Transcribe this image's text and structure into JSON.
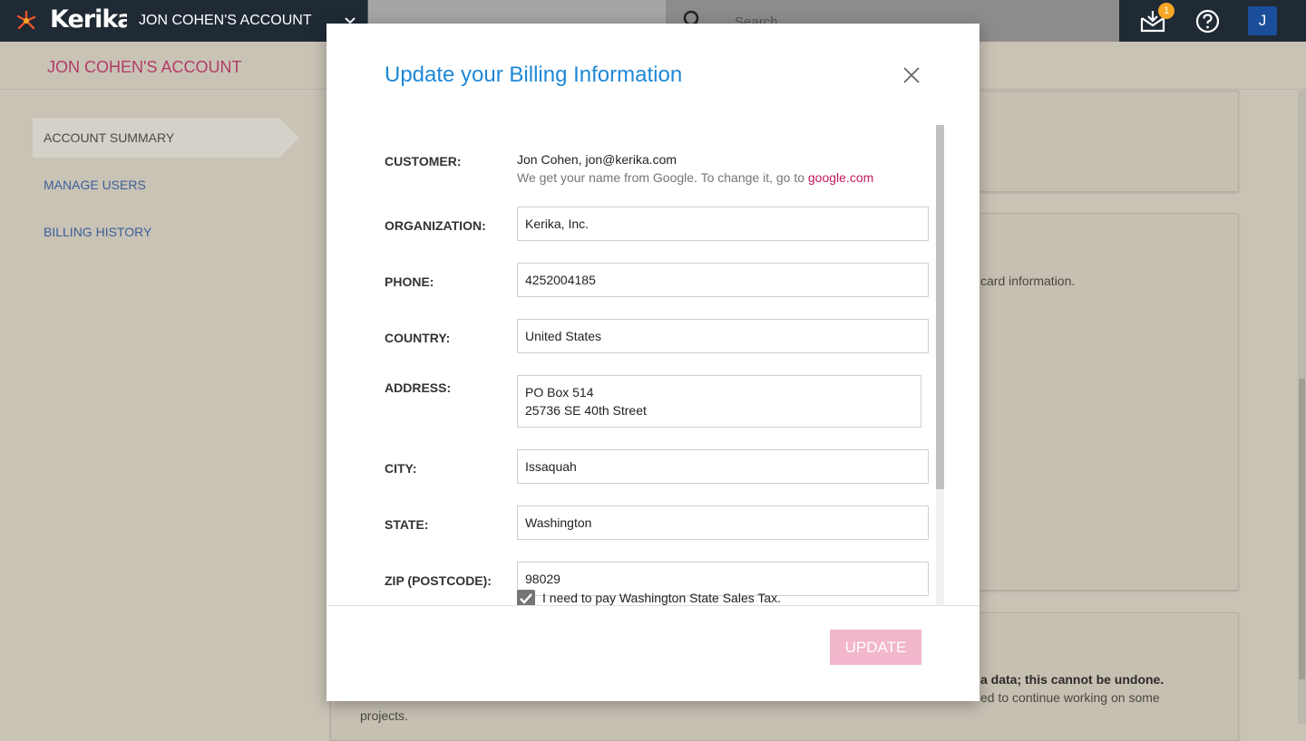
{
  "topbar": {
    "logo_text": "Kerika",
    "account_label": "JON COHEN'S ACCOUNT",
    "search_placeholder": "Search",
    "inbox_count": "1",
    "avatar_initial": "J"
  },
  "subheader": {
    "title": "JON COHEN'S ACCOUNT"
  },
  "sidebar": {
    "items": [
      {
        "label": "ACCOUNT SUMMARY",
        "active": true
      },
      {
        "label": "MANAGE USERS"
      },
      {
        "label": "BILLING HISTORY"
      }
    ]
  },
  "background": {
    "card_text_1": "card information.",
    "card_text_2": "a data; this cannot be undone.",
    "card_text_3": "ed to continue working on some",
    "card_text_4": "projects."
  },
  "modal": {
    "title": "Update your Billing Information",
    "customer": {
      "label": "CUSTOMER:",
      "value": "Jon Cohen, jon@kerika.com",
      "hint_prefix": "We get your name from Google. To change it, go to ",
      "hint_link": "google.com"
    },
    "organization": {
      "label": "ORGANIZATION:",
      "value": "Kerika, Inc."
    },
    "phone": {
      "label": "PHONE:",
      "value": "4252004185"
    },
    "country": {
      "label": "COUNTRY:",
      "value": "United States"
    },
    "address": {
      "label": "ADDRESS:",
      "line1": "PO Box 514",
      "line2": "25736 SE 40th Street"
    },
    "city": {
      "label": "CITY:",
      "value": "Issaquah"
    },
    "state": {
      "label": "STATE:",
      "value": "Washington"
    },
    "zip": {
      "label": "ZIP (POSTCODE):",
      "value": "98029"
    },
    "sales_tax_label": "I need to pay Washington State Sales Tax.",
    "sales_tax_checked": true,
    "update_label": "UPDATE"
  },
  "colors": {
    "accent_blue": "#1e88d6",
    "link_pink": "#c2185b",
    "account_title": "#b23c66",
    "update_button": "#f2b6cd",
    "topbar_dark": "#1f2a35",
    "badge": "#f5a623"
  }
}
